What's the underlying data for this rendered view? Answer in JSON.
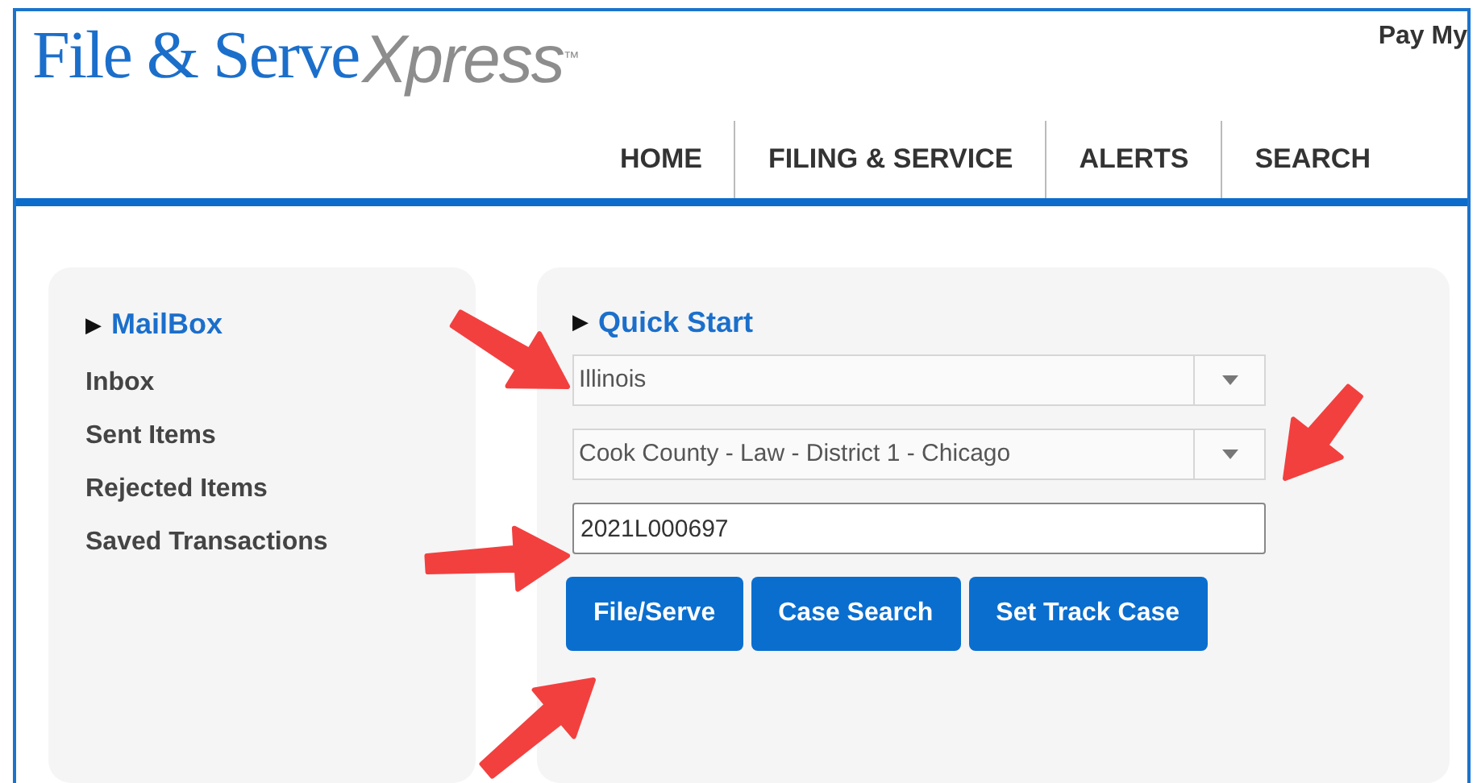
{
  "logo": {
    "brand": "File & Serve",
    "suffix": "Xpress",
    "mark": "™"
  },
  "top_link": "Pay My",
  "nav": [
    {
      "label": "HOME"
    },
    {
      "label": "FILING & SERVICE"
    },
    {
      "label": "ALERTS"
    },
    {
      "label": "SEARCH"
    }
  ],
  "mailbox": {
    "marker": "▶",
    "title": "MailBox",
    "items": [
      "Inbox",
      "Sent Items",
      "Rejected Items",
      "Saved Transactions"
    ]
  },
  "quick_start": {
    "marker": "▶",
    "title": "Quick Start",
    "state_select": "Illinois",
    "court_select": "Cook County - Law - District 1 - Chicago",
    "case_number": "2021L000697",
    "buttons": [
      "File/Serve",
      "Case Search",
      "Set Track Case"
    ]
  }
}
